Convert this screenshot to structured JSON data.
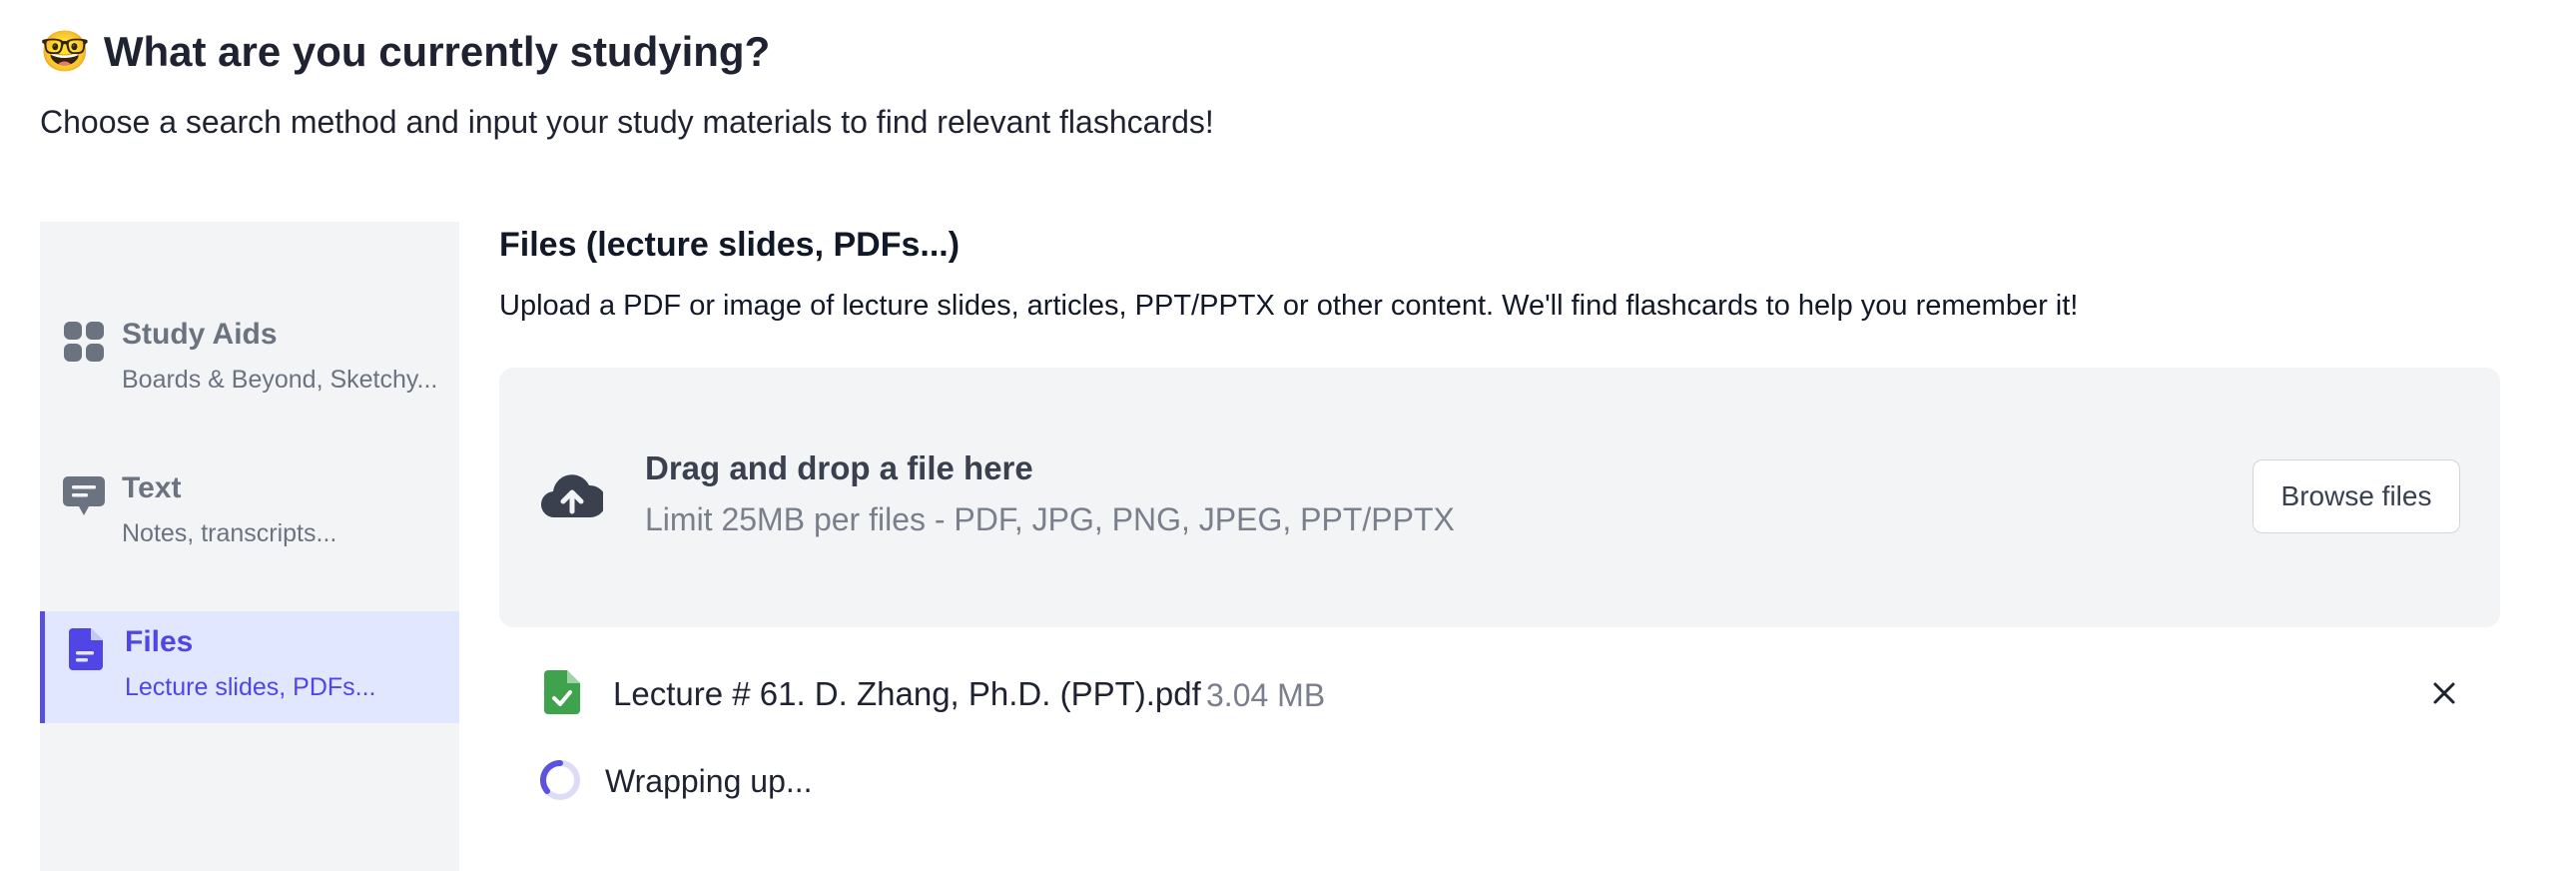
{
  "header": {
    "emoji": "🤓",
    "title": "What are you currently studying?",
    "subtitle": "Choose a search method and input your study materials to find relevant flashcards!"
  },
  "sidebar": {
    "items": [
      {
        "label": "Study Aids",
        "sub": "Boards & Beyond, Sketchy...",
        "icon": "grid-icon",
        "active": false
      },
      {
        "label": "Text",
        "sub": "Notes, transcripts...",
        "icon": "chat-icon",
        "active": false
      },
      {
        "label": "Files",
        "sub": "Lecture slides, PDFs...",
        "icon": "document-icon",
        "active": true
      }
    ]
  },
  "main": {
    "title": "Files (lecture slides, PDFs...)",
    "description": "Upload a PDF or image of lecture slides, articles, PPT/PPTX or other content. We'll find flashcards to help you remember it!",
    "dropzone": {
      "title": "Drag and drop a file here",
      "limit": "Limit 25MB per files - PDF, JPG, PNG, JPEG, PPT/PPTX",
      "browse_label": "Browse files",
      "icon": "cloud-upload-icon"
    },
    "file": {
      "name": "Lecture # 61. D. Zhang, Ph.D. (PPT).pdf",
      "size": "3.04 MB",
      "icon": "file-check-icon"
    },
    "progress": {
      "text": "Wrapping up..."
    }
  },
  "colors": {
    "accent": "#4f46e5",
    "sidebar_bg": "#f3f4f6",
    "active_bg": "#e0e7ff",
    "file_icon": "#3fa34d",
    "muted": "#6b7280"
  }
}
